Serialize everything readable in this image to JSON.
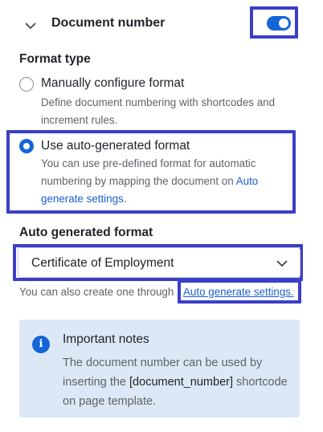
{
  "section": {
    "title": "Document number",
    "toggle_on": true
  },
  "format_type": {
    "label": "Format type",
    "options": [
      {
        "label": "Manually configure format",
        "description": "Define document numbering with shortcodes and increment rules.",
        "selected": false
      },
      {
        "label": "Use auto-generated format",
        "description": "You can use pre-defined format for automatic numbering by mapping the document on ",
        "link_text": "Auto generate settings",
        "suffix": ".",
        "selected": true
      }
    ]
  },
  "auto_format": {
    "label": "Auto generated format",
    "selected_value": "Certificate of Employment",
    "helper_text": "You can also create one through",
    "helper_link": "Auto generate settings."
  },
  "notes": {
    "icon": "info-icon",
    "title": "Important notes",
    "body_before": "The document number can be used by inserting the ",
    "code": "[document_number]",
    "body_after": " shortcode on page template."
  },
  "colors": {
    "accent": "#1565d8",
    "highlight": "#3b3fc7",
    "notes_bg": "#dce8f5"
  }
}
